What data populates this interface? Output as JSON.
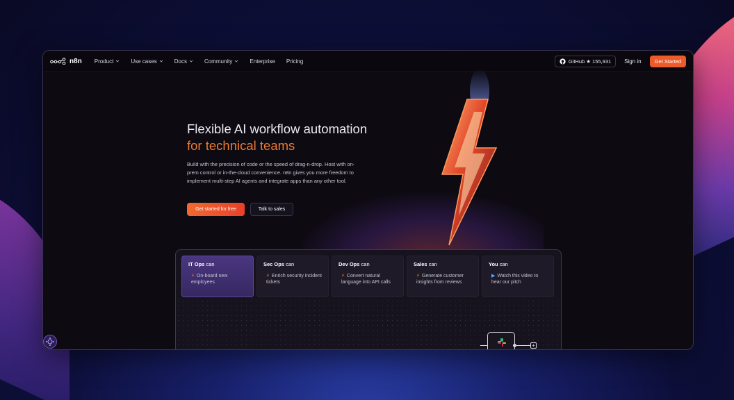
{
  "nav": {
    "brand": "n8n",
    "items": [
      {
        "label": "Product",
        "has_dropdown": true
      },
      {
        "label": "Use cases",
        "has_dropdown": true
      },
      {
        "label": "Docs",
        "has_dropdown": true
      },
      {
        "label": "Community",
        "has_dropdown": true
      },
      {
        "label": "Enterprise",
        "has_dropdown": false
      },
      {
        "label": "Pricing",
        "has_dropdown": false
      }
    ],
    "github_label": "GitHub ★ 155,931",
    "signin_label": "Sign in",
    "get_started_label": "Get Started"
  },
  "hero": {
    "title_line1": "Flexible AI workflow automation",
    "title_line2": "for technical teams",
    "body": "Build with the precision of code or the speed of drag-n-drop. Host with on-prem control or in-the-cloud convenience. n8n gives you more freedom to implement multi-step AI agents and integrate apps than any other tool.",
    "cta_primary": "Get started for free",
    "cta_secondary": "Talk to sales"
  },
  "tabs": [
    {
      "role": "IT Ops",
      "suffix": "can",
      "desc": "On-board new employees",
      "icon": "bolt-icon",
      "active": true
    },
    {
      "role": "Sec Ops",
      "suffix": "can",
      "desc": "Enrich security incident tickets",
      "icon": "bolt-icon",
      "active": false
    },
    {
      "role": "Dev Ops",
      "suffix": "can",
      "desc": "Convert natural language into API calls",
      "icon": "bolt-icon",
      "active": false
    },
    {
      "role": "Sales",
      "suffix": "can",
      "desc": "Generate customer insights from reviews",
      "icon": "bolt-icon",
      "active": false
    },
    {
      "role": "You",
      "suffix": "can",
      "desc": "Watch this video to hear our pitch",
      "icon": "play-icon",
      "active": false
    }
  ],
  "colors": {
    "accent_orange": "#ee5b2a",
    "title_orange": "#ee7a30",
    "active_tab": "#4a3680"
  }
}
